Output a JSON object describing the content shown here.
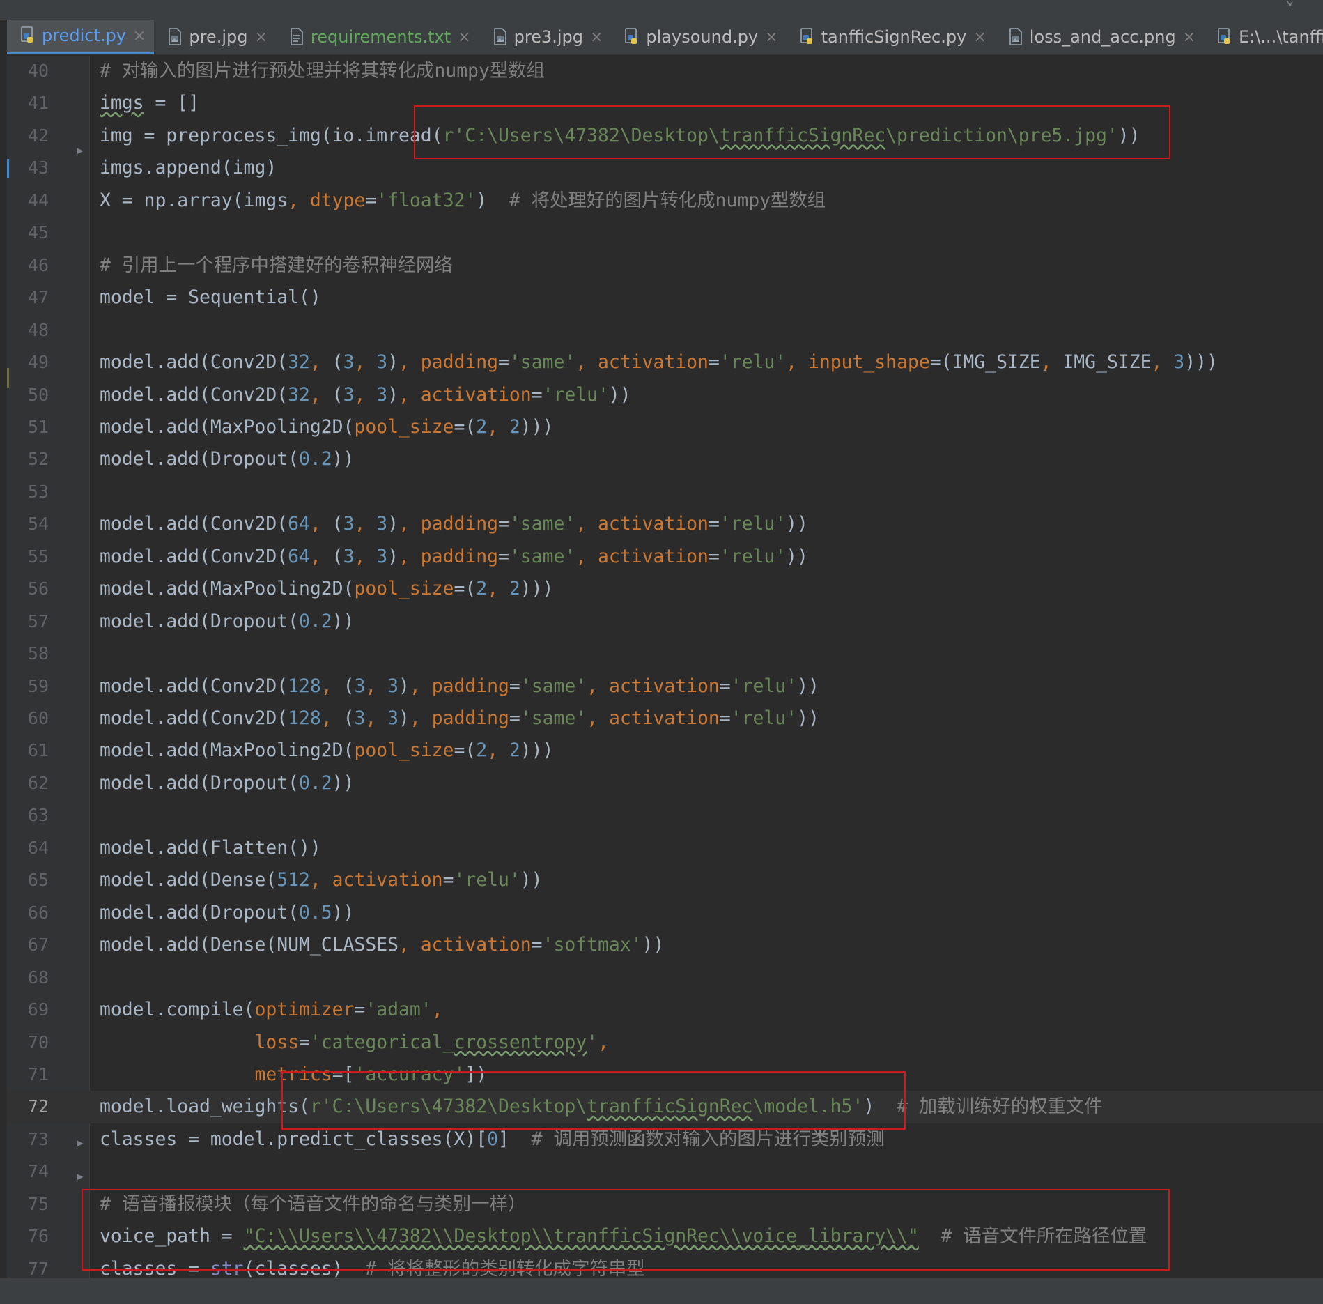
{
  "tabs": [
    {
      "label": "predict.py",
      "kind": "python",
      "state": "active"
    },
    {
      "label": "pre.jpg",
      "kind": "image",
      "state": "normal"
    },
    {
      "label": "requirements.txt",
      "kind": "text",
      "state": "green"
    },
    {
      "label": "pre3.jpg",
      "kind": "image",
      "state": "normal"
    },
    {
      "label": "playsound.py",
      "kind": "python",
      "state": "normal"
    },
    {
      "label": "tanfficSignRec.py",
      "kind": "python",
      "state": "normal"
    },
    {
      "label": "loss_and_acc.png",
      "kind": "image",
      "state": "normal"
    },
    {
      "label": "E:\\...\\tanfficSignRec.py",
      "kind": "python",
      "state": "normal"
    }
  ],
  "close_glyph": "×",
  "colors": {
    "background": "#2b2b2b",
    "comment": "#808080",
    "string": "#6a8759",
    "number": "#6897bb",
    "param": "#aa4926",
    "keyword": "#cc7832",
    "highlight_box": "#d01a1a",
    "active_tab": "#589df6"
  },
  "current_line": "72",
  "lines": [
    {
      "n": "40",
      "segs": [
        [
          "cmt",
          "# 对输入的图片进行预处理并将其转化成numpy型数组"
        ]
      ]
    },
    {
      "n": "41",
      "segs": [
        [
          "wavy",
          "imgs"
        ],
        [
          "",
          " = []"
        ]
      ]
    },
    {
      "n": "42",
      "segs": [
        [
          "",
          "img = preprocess_img(io.imread("
        ],
        [
          "str",
          "r'C:\\Users\\47382\\Desktop\\"
        ],
        [
          "str wavy",
          "tranfficSignRec"
        ],
        [
          "str",
          "\\prediction\\pre5.jpg'"
        ],
        [
          "",
          "))"
        ]
      ]
    },
    {
      "n": "43",
      "segs": [
        [
          "",
          "imgs.append(img)"
        ]
      ]
    },
    {
      "n": "44",
      "segs": [
        [
          "",
          "X = np.array(imgs"
        ],
        [
          "kw",
          ", "
        ],
        [
          "pnf",
          "dtype"
        ],
        [
          "",
          "="
        ],
        [
          "str",
          "'float32'"
        ],
        [
          "",
          ")  "
        ],
        [
          "cmt",
          "# 将处理好的图片转化成numpy型数组"
        ]
      ]
    },
    {
      "n": "45",
      "segs": []
    },
    {
      "n": "46",
      "segs": [
        [
          "cmt",
          "# 引用上一个程序中搭建好的卷积神经网络"
        ]
      ]
    },
    {
      "n": "47",
      "segs": [
        [
          "",
          "model = Sequential()"
        ]
      ]
    },
    {
      "n": "48",
      "segs": []
    },
    {
      "n": "49",
      "segs": [
        [
          "",
          "model.add(Conv2D("
        ],
        [
          "num",
          "32"
        ],
        [
          "kw",
          ", "
        ],
        [
          "",
          "("
        ],
        [
          "num",
          "3"
        ],
        [
          "kw",
          ", "
        ],
        [
          "num",
          "3"
        ],
        [
          "",
          ")"
        ],
        [
          "kw",
          ", "
        ],
        [
          "pnf",
          "padding"
        ],
        [
          "",
          "="
        ],
        [
          "str",
          "'same'"
        ],
        [
          "kw",
          ", "
        ],
        [
          "pnf",
          "activation"
        ],
        [
          "",
          "="
        ],
        [
          "str",
          "'relu'"
        ],
        [
          "kw",
          ", "
        ],
        [
          "pnf",
          "input_shape"
        ],
        [
          "",
          "=(IMG_SIZE"
        ],
        [
          "kw",
          ", "
        ],
        [
          "",
          "IMG_SIZE"
        ],
        [
          "kw",
          ", "
        ],
        [
          "num",
          "3"
        ],
        [
          "",
          ")))"
        ]
      ]
    },
    {
      "n": "50",
      "segs": [
        [
          "",
          "model.add(Conv2D("
        ],
        [
          "num",
          "32"
        ],
        [
          "kw",
          ", "
        ],
        [
          "",
          "("
        ],
        [
          "num",
          "3"
        ],
        [
          "kw",
          ", "
        ],
        [
          "num",
          "3"
        ],
        [
          "",
          ")"
        ],
        [
          "kw",
          ", "
        ],
        [
          "pnf",
          "activation"
        ],
        [
          "",
          "="
        ],
        [
          "str",
          "'relu'"
        ],
        [
          "",
          "))"
        ]
      ]
    },
    {
      "n": "51",
      "segs": [
        [
          "",
          "model.add(MaxPooling2D("
        ],
        [
          "pnf",
          "pool_size"
        ],
        [
          "",
          "=("
        ],
        [
          "num",
          "2"
        ],
        [
          "kw",
          ", "
        ],
        [
          "num",
          "2"
        ],
        [
          "",
          ")))"
        ]
      ]
    },
    {
      "n": "52",
      "segs": [
        [
          "",
          "model.add(Dropout("
        ],
        [
          "num",
          "0.2"
        ],
        [
          "",
          "))"
        ]
      ]
    },
    {
      "n": "53",
      "segs": []
    },
    {
      "n": "54",
      "segs": [
        [
          "",
          "model.add(Conv2D("
        ],
        [
          "num",
          "64"
        ],
        [
          "kw",
          ", "
        ],
        [
          "",
          "("
        ],
        [
          "num",
          "3"
        ],
        [
          "kw",
          ", "
        ],
        [
          "num",
          "3"
        ],
        [
          "",
          ")"
        ],
        [
          "kw",
          ", "
        ],
        [
          "pnf",
          "padding"
        ],
        [
          "",
          "="
        ],
        [
          "str",
          "'same'"
        ],
        [
          "kw",
          ", "
        ],
        [
          "pnf",
          "activation"
        ],
        [
          "",
          "="
        ],
        [
          "str",
          "'relu'"
        ],
        [
          "",
          "))"
        ]
      ]
    },
    {
      "n": "55",
      "segs": [
        [
          "",
          "model.add(Conv2D("
        ],
        [
          "num",
          "64"
        ],
        [
          "kw",
          ", "
        ],
        [
          "",
          "("
        ],
        [
          "num",
          "3"
        ],
        [
          "kw",
          ", "
        ],
        [
          "num",
          "3"
        ],
        [
          "",
          ")"
        ],
        [
          "kw",
          ", "
        ],
        [
          "pnf",
          "padding"
        ],
        [
          "",
          "="
        ],
        [
          "str",
          "'same'"
        ],
        [
          "kw",
          ", "
        ],
        [
          "pnf",
          "activation"
        ],
        [
          "",
          "="
        ],
        [
          "str",
          "'relu'"
        ],
        [
          "",
          "))"
        ]
      ]
    },
    {
      "n": "56",
      "segs": [
        [
          "",
          "model.add(MaxPooling2D("
        ],
        [
          "pnf",
          "pool_size"
        ],
        [
          "",
          "=("
        ],
        [
          "num",
          "2"
        ],
        [
          "kw",
          ", "
        ],
        [
          "num",
          "2"
        ],
        [
          "",
          ")))"
        ]
      ]
    },
    {
      "n": "57",
      "segs": [
        [
          "",
          "model.add(Dropout("
        ],
        [
          "num",
          "0.2"
        ],
        [
          "",
          "))"
        ]
      ]
    },
    {
      "n": "58",
      "segs": []
    },
    {
      "n": "59",
      "segs": [
        [
          "",
          "model.add(Conv2D("
        ],
        [
          "num",
          "128"
        ],
        [
          "kw",
          ", "
        ],
        [
          "",
          "("
        ],
        [
          "num",
          "3"
        ],
        [
          "kw",
          ", "
        ],
        [
          "num",
          "3"
        ],
        [
          "",
          ")"
        ],
        [
          "kw",
          ", "
        ],
        [
          "pnf",
          "padding"
        ],
        [
          "",
          "="
        ],
        [
          "str",
          "'same'"
        ],
        [
          "kw",
          ", "
        ],
        [
          "pnf",
          "activation"
        ],
        [
          "",
          "="
        ],
        [
          "str",
          "'relu'"
        ],
        [
          "",
          "))"
        ]
      ]
    },
    {
      "n": "60",
      "segs": [
        [
          "",
          "model.add(Conv2D("
        ],
        [
          "num",
          "128"
        ],
        [
          "kw",
          ", "
        ],
        [
          "",
          "("
        ],
        [
          "num",
          "3"
        ],
        [
          "kw",
          ", "
        ],
        [
          "num",
          "3"
        ],
        [
          "",
          ")"
        ],
        [
          "kw",
          ", "
        ],
        [
          "pnf",
          "padding"
        ],
        [
          "",
          "="
        ],
        [
          "str",
          "'same'"
        ],
        [
          "kw",
          ", "
        ],
        [
          "pnf",
          "activation"
        ],
        [
          "",
          "="
        ],
        [
          "str",
          "'relu'"
        ],
        [
          "",
          "))"
        ]
      ]
    },
    {
      "n": "61",
      "segs": [
        [
          "",
          "model.add(MaxPooling2D("
        ],
        [
          "pnf",
          "pool_size"
        ],
        [
          "",
          "=("
        ],
        [
          "num",
          "2"
        ],
        [
          "kw",
          ", "
        ],
        [
          "num",
          "2"
        ],
        [
          "",
          ")))"
        ]
      ]
    },
    {
      "n": "62",
      "segs": [
        [
          "",
          "model.add(Dropout("
        ],
        [
          "num",
          "0.2"
        ],
        [
          "",
          "))"
        ]
      ]
    },
    {
      "n": "63",
      "segs": []
    },
    {
      "n": "64",
      "segs": [
        [
          "",
          "model.add(Flatten())"
        ]
      ]
    },
    {
      "n": "65",
      "segs": [
        [
          "",
          "model.add(Dense("
        ],
        [
          "num",
          "512"
        ],
        [
          "kw",
          ", "
        ],
        [
          "pnf",
          "activation"
        ],
        [
          "",
          "="
        ],
        [
          "str",
          "'relu'"
        ],
        [
          "",
          "))"
        ]
      ]
    },
    {
      "n": "66",
      "segs": [
        [
          "",
          "model.add(Dropout("
        ],
        [
          "num",
          "0.5"
        ],
        [
          "",
          "))"
        ]
      ]
    },
    {
      "n": "67",
      "segs": [
        [
          "",
          "model.add(Dense(NUM_CLASSES"
        ],
        [
          "kw",
          ", "
        ],
        [
          "pnf",
          "activation"
        ],
        [
          "",
          "="
        ],
        [
          "str",
          "'softmax'"
        ],
        [
          "",
          "))"
        ]
      ]
    },
    {
      "n": "68",
      "segs": []
    },
    {
      "n": "69",
      "segs": [
        [
          "",
          "model.compile("
        ],
        [
          "pnf",
          "optimizer"
        ],
        [
          "",
          "="
        ],
        [
          "str",
          "'adam'"
        ],
        [
          "kw",
          ","
        ]
      ]
    },
    {
      "n": "70",
      "segs": [
        [
          "",
          "              "
        ],
        [
          "pnf",
          "loss"
        ],
        [
          "",
          "="
        ],
        [
          "str",
          "'categorical_"
        ],
        [
          "str wavy",
          "crossentropy"
        ],
        [
          "str",
          "'"
        ],
        [
          "kw",
          ","
        ]
      ]
    },
    {
      "n": "71",
      "segs": [
        [
          "",
          "              "
        ],
        [
          "pnf",
          "metrics"
        ],
        [
          "",
          "=["
        ],
        [
          "str",
          "'accuracy'"
        ],
        [
          "",
          "])"
        ]
      ]
    },
    {
      "n": "72",
      "segs": [
        [
          "",
          "model.load_weights("
        ],
        [
          "str",
          "r'C:\\Users\\47382\\Desktop\\"
        ],
        [
          "str wavy",
          "tranfficSignRec"
        ],
        [
          "str",
          "\\model.h5'"
        ],
        [
          "",
          ")  "
        ],
        [
          "cmt",
          "# 加载训练好的权重文件"
        ]
      ]
    },
    {
      "n": "73",
      "segs": [
        [
          "",
          "classes = model.predict_classes(X)["
        ],
        [
          "num",
          "0"
        ],
        [
          "",
          "]  "
        ],
        [
          "cmt",
          "# 调用预测函数对输入的图片进行类别预测"
        ]
      ]
    },
    {
      "n": "74",
      "segs": []
    },
    {
      "n": "75",
      "segs": [
        [
          "cmt",
          "# 语音播报模块（每个语音文件的命名与类别一样）"
        ]
      ]
    },
    {
      "n": "76",
      "segs": [
        [
          "",
          "voice_path = "
        ],
        [
          "str wavy",
          "\"C:\\\\Users\\\\47382\\\\Desktop\\\\tranfficSignRec\\\\voice_library\\\\\""
        ],
        [
          "",
          "  "
        ],
        [
          "cmt",
          "# 语音文件所在路径位置"
        ]
      ]
    },
    {
      "n": "77",
      "segs": [
        [
          "",
          "classes = "
        ],
        [
          "bi",
          "str"
        ],
        [
          "",
          "(classes)  "
        ],
        [
          "cmt",
          "# 将将整形的类别转化成字符串型"
        ]
      ]
    }
  ]
}
